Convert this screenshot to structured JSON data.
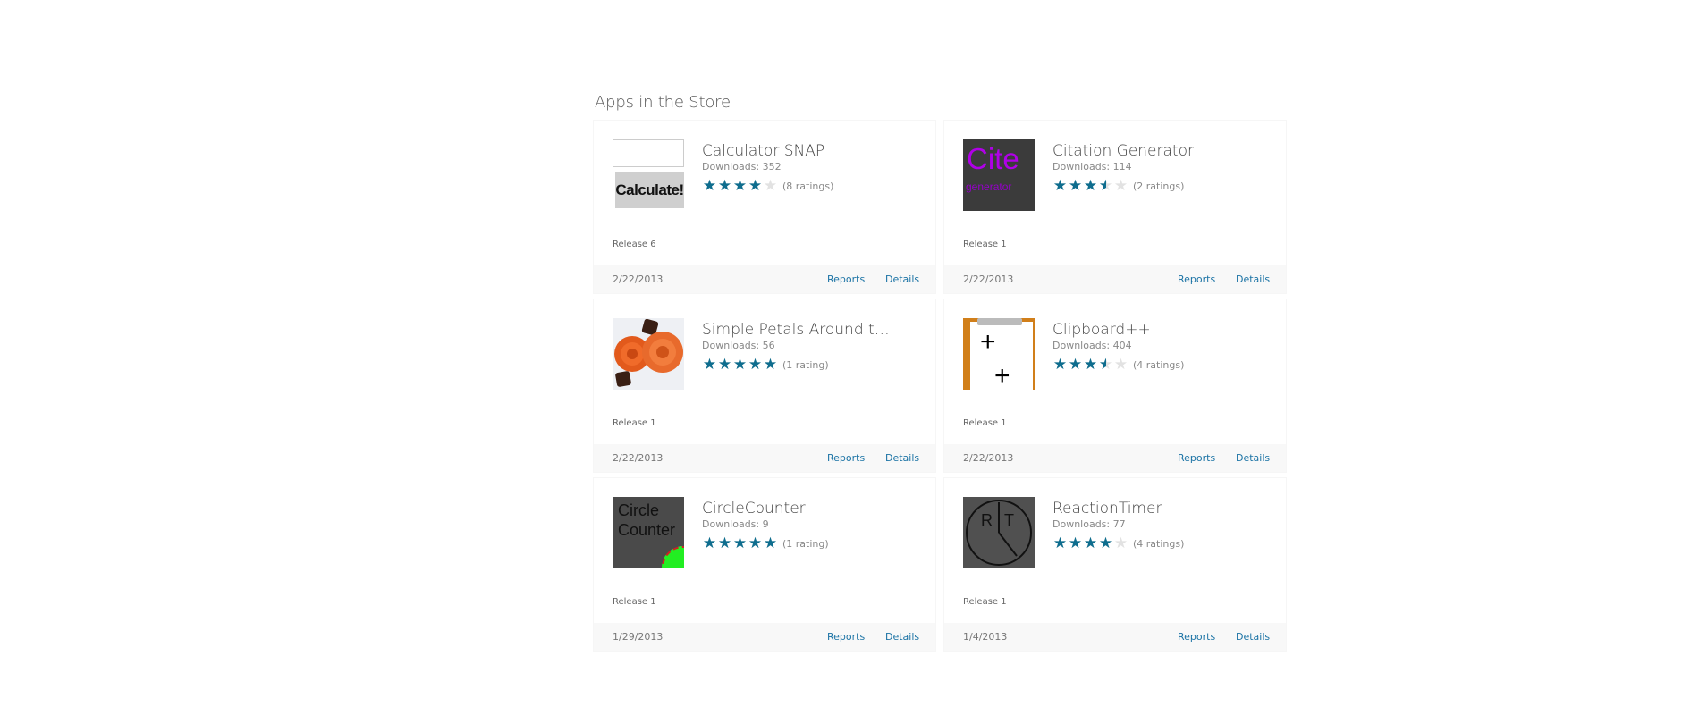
{
  "section": {
    "title": "Apps in the Store"
  },
  "icons": {
    "star": "star-icon",
    "star_color": "#0e6d8e",
    "star_empty_color": "#e2e2e2",
    "link_color": "#1b73a5"
  },
  "apps": [
    {
      "name": "Calculator SNAP",
      "downloads": "Downloads: 352",
      "rating": 4,
      "ratings_count": "(8 ratings)",
      "release": "Release 6",
      "date": "2/22/2013",
      "reports_label": "Reports",
      "details_label": "Details",
      "thumb": {
        "button_text": "Calculate!"
      }
    },
    {
      "name": "Citation Generator",
      "downloads": "Downloads: 114",
      "rating": 3.5,
      "ratings_count": "(2 ratings)",
      "release": "Release 1",
      "date": "2/22/2013",
      "reports_label": "Reports",
      "details_label": "Details",
      "thumb": {
        "line1": "Cite",
        "line2": "generator"
      }
    },
    {
      "name": "Simple Petals Around the R...",
      "downloads": "Downloads: 56",
      "rating": 5,
      "ratings_count": "(1 rating)",
      "release": "Release 1",
      "date": "2/22/2013",
      "reports_label": "Reports",
      "details_label": "Details",
      "thumb": {}
    },
    {
      "name": "Clipboard++",
      "downloads": "Downloads: 404",
      "rating": 3.5,
      "ratings_count": "(4 ratings)",
      "release": "Release 1",
      "date": "2/22/2013",
      "reports_label": "Reports",
      "details_label": "Details",
      "thumb": {
        "plus1": "+",
        "plus2": "+"
      }
    },
    {
      "name": "CircleCounter",
      "downloads": "Downloads: 9",
      "rating": 5,
      "ratings_count": "(1 rating)",
      "release": "Release 1",
      "date": "1/29/2013",
      "reports_label": "Reports",
      "details_label": "Details",
      "thumb": {
        "line1": "Circle",
        "line2": "Counter"
      }
    },
    {
      "name": "ReactionTimer",
      "downloads": "Downloads: 77",
      "rating": 4,
      "ratings_count": "(4 ratings)",
      "release": "Release 1",
      "date": "1/4/2013",
      "reports_label": "Reports",
      "details_label": "Details",
      "thumb": {
        "letter_r": "R",
        "letter_t": "T"
      }
    }
  ]
}
